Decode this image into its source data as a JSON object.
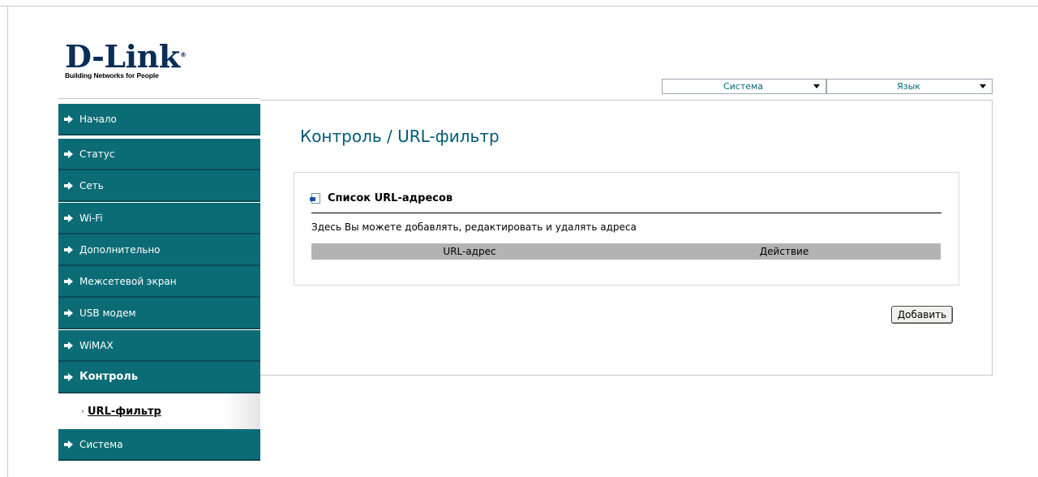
{
  "brand": {
    "logo_text": "D-Link",
    "registered": "®",
    "tagline": "Building Networks for People"
  },
  "top_bar": {
    "system_select": "Система",
    "language_select": "Язык"
  },
  "sidebar": {
    "items": [
      {
        "label": "Начало"
      },
      {
        "label": "Статус"
      },
      {
        "label": "Сеть"
      },
      {
        "label": "Wi-Fi"
      },
      {
        "label": "Дополнительно"
      },
      {
        "label": "Межсетевой экран"
      },
      {
        "label": "USB модем"
      },
      {
        "label": "WiMAX"
      },
      {
        "label": "Контроль",
        "active": true
      },
      {
        "label": "Система"
      }
    ],
    "subitem": {
      "bullet": "›",
      "label": "URL-фильтр"
    }
  },
  "main": {
    "title": "Контроль  /  URL-фильтр",
    "section": {
      "title": "Список URL-адресов",
      "description": "Здесь Вы можете добавлять, редактировать и удалять адреса",
      "columns": [
        "URL-адрес",
        "Действие"
      ],
      "rows": []
    },
    "add_button": "Добавить"
  },
  "icons": {
    "nav_arrow": "arrow-right-icon",
    "section_icon": "document-icon",
    "dropdown": "chevron-down-icon"
  },
  "colors": {
    "nav_bg": "#0b6c76",
    "title": "#005a74",
    "select_text": "#006a7a",
    "logo": "#0b2e57",
    "table_header": "#b3b3b3"
  }
}
